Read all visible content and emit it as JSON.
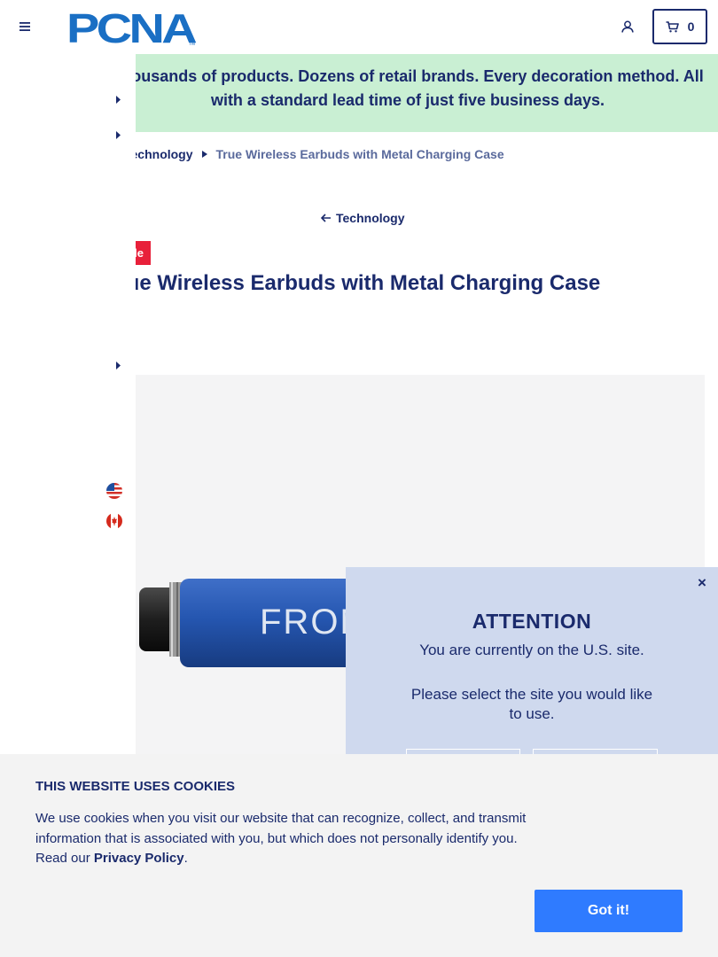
{
  "header": {
    "logo_text": "PCNA",
    "logo_mark": "TM",
    "cart_count": "0"
  },
  "banner": {
    "text": "Thousands of products. Dozens of retail brands. Every decoration method. All with a standard lead time of just five business days."
  },
  "breadcrumb": {
    "items": [
      "Technology",
      "True Wireless Earbuds with Metal Charging Case"
    ]
  },
  "back_link": {
    "label": "Technology"
  },
  "product": {
    "badge": "Sale",
    "title": "True Wireless Earbuds with Metal Charging Case",
    "image_text": "FRON"
  },
  "site_modal": {
    "heading": "ATTENTION",
    "line1": "You are currently on the U.S. site.",
    "line2": "Please select the site you would like to use.",
    "close_label": "×"
  },
  "cookie": {
    "title": "THIS WEBSITE USES COOKIES",
    "body": "We use cookies when you visit our website that can recognize, collect, and transmit information that is associated with you, but which does not personally identify you. Read our ",
    "link_label": "Privacy Policy",
    "period": ".",
    "button_label": "Got it!"
  },
  "colors": {
    "navy": "#1a2a6c",
    "banner_green": "#c9efd3",
    "sale_red": "#e8203a",
    "modal_blue": "#cfd9ee",
    "button_blue": "#2f7bff",
    "logo_blue": "#1a6fc4"
  },
  "icons": {
    "menu": "hamburger-icon",
    "account": "user-icon",
    "cart": "cart-icon",
    "back": "arrow-left-icon",
    "caret": "caret-right-icon",
    "flag_us": "us-flag-icon",
    "flag_ca": "canada-flag-icon",
    "close": "close-icon"
  }
}
